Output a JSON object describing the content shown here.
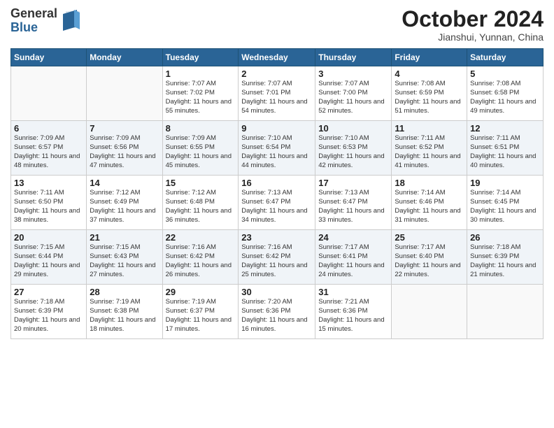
{
  "header": {
    "logo_line1": "General",
    "logo_line2": "Blue",
    "month": "October 2024",
    "location": "Jianshui, Yunnan, China"
  },
  "weekdays": [
    "Sunday",
    "Monday",
    "Tuesday",
    "Wednesday",
    "Thursday",
    "Friday",
    "Saturday"
  ],
  "weeks": [
    [
      null,
      null,
      {
        "day": "1",
        "sunrise": "7:07 AM",
        "sunset": "7:02 PM",
        "daylight": "11 hours and 55 minutes."
      },
      {
        "day": "2",
        "sunrise": "7:07 AM",
        "sunset": "7:01 PM",
        "daylight": "11 hours and 54 minutes."
      },
      {
        "day": "3",
        "sunrise": "7:07 AM",
        "sunset": "7:00 PM",
        "daylight": "11 hours and 52 minutes."
      },
      {
        "day": "4",
        "sunrise": "7:08 AM",
        "sunset": "6:59 PM",
        "daylight": "11 hours and 51 minutes."
      },
      {
        "day": "5",
        "sunrise": "7:08 AM",
        "sunset": "6:58 PM",
        "daylight": "11 hours and 49 minutes."
      }
    ],
    [
      {
        "day": "6",
        "sunrise": "7:09 AM",
        "sunset": "6:57 PM",
        "daylight": "11 hours and 48 minutes."
      },
      {
        "day": "7",
        "sunrise": "7:09 AM",
        "sunset": "6:56 PM",
        "daylight": "11 hours and 47 minutes."
      },
      {
        "day": "8",
        "sunrise": "7:09 AM",
        "sunset": "6:55 PM",
        "daylight": "11 hours and 45 minutes."
      },
      {
        "day": "9",
        "sunrise": "7:10 AM",
        "sunset": "6:54 PM",
        "daylight": "11 hours and 44 minutes."
      },
      {
        "day": "10",
        "sunrise": "7:10 AM",
        "sunset": "6:53 PM",
        "daylight": "11 hours and 42 minutes."
      },
      {
        "day": "11",
        "sunrise": "7:11 AM",
        "sunset": "6:52 PM",
        "daylight": "11 hours and 41 minutes."
      },
      {
        "day": "12",
        "sunrise": "7:11 AM",
        "sunset": "6:51 PM",
        "daylight": "11 hours and 40 minutes."
      }
    ],
    [
      {
        "day": "13",
        "sunrise": "7:11 AM",
        "sunset": "6:50 PM",
        "daylight": "11 hours and 38 minutes."
      },
      {
        "day": "14",
        "sunrise": "7:12 AM",
        "sunset": "6:49 PM",
        "daylight": "11 hours and 37 minutes."
      },
      {
        "day": "15",
        "sunrise": "7:12 AM",
        "sunset": "6:48 PM",
        "daylight": "11 hours and 36 minutes."
      },
      {
        "day": "16",
        "sunrise": "7:13 AM",
        "sunset": "6:47 PM",
        "daylight": "11 hours and 34 minutes."
      },
      {
        "day": "17",
        "sunrise": "7:13 AM",
        "sunset": "6:47 PM",
        "daylight": "11 hours and 33 minutes."
      },
      {
        "day": "18",
        "sunrise": "7:14 AM",
        "sunset": "6:46 PM",
        "daylight": "11 hours and 31 minutes."
      },
      {
        "day": "19",
        "sunrise": "7:14 AM",
        "sunset": "6:45 PM",
        "daylight": "11 hours and 30 minutes."
      }
    ],
    [
      {
        "day": "20",
        "sunrise": "7:15 AM",
        "sunset": "6:44 PM",
        "daylight": "11 hours and 29 minutes."
      },
      {
        "day": "21",
        "sunrise": "7:15 AM",
        "sunset": "6:43 PM",
        "daylight": "11 hours and 27 minutes."
      },
      {
        "day": "22",
        "sunrise": "7:16 AM",
        "sunset": "6:42 PM",
        "daylight": "11 hours and 26 minutes."
      },
      {
        "day": "23",
        "sunrise": "7:16 AM",
        "sunset": "6:42 PM",
        "daylight": "11 hours and 25 minutes."
      },
      {
        "day": "24",
        "sunrise": "7:17 AM",
        "sunset": "6:41 PM",
        "daylight": "11 hours and 24 minutes."
      },
      {
        "day": "25",
        "sunrise": "7:17 AM",
        "sunset": "6:40 PM",
        "daylight": "11 hours and 22 minutes."
      },
      {
        "day": "26",
        "sunrise": "7:18 AM",
        "sunset": "6:39 PM",
        "daylight": "11 hours and 21 minutes."
      }
    ],
    [
      {
        "day": "27",
        "sunrise": "7:18 AM",
        "sunset": "6:39 PM",
        "daylight": "11 hours and 20 minutes."
      },
      {
        "day": "28",
        "sunrise": "7:19 AM",
        "sunset": "6:38 PM",
        "daylight": "11 hours and 18 minutes."
      },
      {
        "day": "29",
        "sunrise": "7:19 AM",
        "sunset": "6:37 PM",
        "daylight": "11 hours and 17 minutes."
      },
      {
        "day": "30",
        "sunrise": "7:20 AM",
        "sunset": "6:36 PM",
        "daylight": "11 hours and 16 minutes."
      },
      {
        "day": "31",
        "sunrise": "7:21 AM",
        "sunset": "6:36 PM",
        "daylight": "11 hours and 15 minutes."
      },
      null,
      null
    ]
  ]
}
